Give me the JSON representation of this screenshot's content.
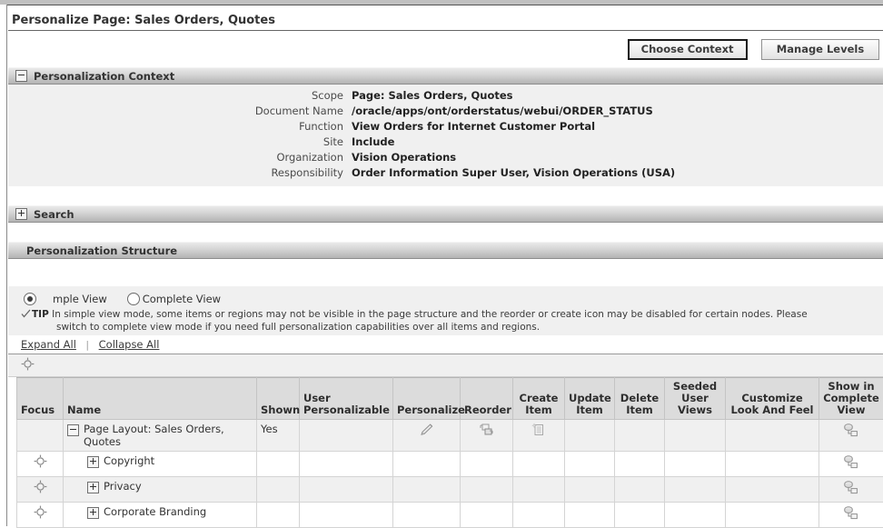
{
  "page": {
    "title": "Personalize Page: Sales Orders, Quotes"
  },
  "toolbar": {
    "choose_context_label": "Choose Context",
    "manage_levels_label": "Manage Levels"
  },
  "context_section": {
    "header": "Personalization Context",
    "toggle_icon": "minus-icon",
    "rows": [
      {
        "label": "Scope",
        "value": "Page: Sales Orders, Quotes"
      },
      {
        "label": "Document Name",
        "value": "/oracle/apps/ont/orderstatus/webui/ORDER_STATUS"
      },
      {
        "label": "Function",
        "value": "View Orders for Internet Customer Portal"
      },
      {
        "label": "Site",
        "value": "Include"
      },
      {
        "label": "Organization",
        "value": "Vision Operations"
      },
      {
        "label": "Responsibility",
        "value": "Order Information Super User, Vision Operations (USA)"
      }
    ]
  },
  "search_section": {
    "header": "Search",
    "toggle_icon": "plus-icon"
  },
  "structure_section": {
    "header": "Personalization Structure",
    "view_modes": [
      {
        "label": "mple View",
        "selected": true
      },
      {
        "label": "Complete View",
        "selected": false
      }
    ],
    "tip_label": "TIP",
    "tip_line1": "In simple view mode, some items or regions may not be visible in the page structure and the reorder or create icon may be disabled for certain nodes. Please",
    "tip_line2": "switch to complete view mode if you need full personalization capabilities over all items and regions.",
    "expand_all_label": "Expand All",
    "collapse_all_label": "Collapse All",
    "link_separator": "|"
  },
  "table": {
    "columns": [
      {
        "key": "focus",
        "label": "Focus",
        "align": "left"
      },
      {
        "key": "name",
        "label": "Name",
        "align": "left"
      },
      {
        "key": "shown",
        "label": "Shown",
        "align": "left"
      },
      {
        "key": "user_personalizable",
        "label": "User\nPersonalizable",
        "align": "left"
      },
      {
        "key": "personalize",
        "label": "Personalize",
        "align": "left"
      },
      {
        "key": "reorder",
        "label": "Reorder",
        "align": "left"
      },
      {
        "key": "create_item",
        "label": "Create\nItem",
        "align": "center"
      },
      {
        "key": "update_item",
        "label": "Update\nItem",
        "align": "center"
      },
      {
        "key": "delete_item",
        "label": "Delete\nItem",
        "align": "center"
      },
      {
        "key": "seeded_user_views",
        "label": "Seeded\nUser\nViews",
        "align": "center"
      },
      {
        "key": "customize_look_and_feel",
        "label": "Customize\nLook And Feel",
        "align": "center"
      },
      {
        "key": "show_in_complete_view",
        "label": "Show in\nComplete\nView",
        "align": "center"
      }
    ],
    "column_labels": {
      "focus": "Focus",
      "name": "Name",
      "shown": "Shown",
      "user_personalizable_l1": "User",
      "user_personalizable_l2": "Personalizable",
      "personalize": "Personalize",
      "reorder": "Reorder",
      "create_item_l1": "Create",
      "create_item_l2": "Item",
      "update_item_l1": "Update",
      "update_item_l2": "Item",
      "delete_item_l1": "Delete",
      "delete_item_l2": "Item",
      "seeded_l1": "Seeded",
      "seeded_l2": "User",
      "seeded_l3": "Views",
      "clf_l1": "Customize",
      "clf_l2": "Look And Feel",
      "sicv_l1": "Show in",
      "sicv_l2": "Complete",
      "sicv_l3": "View"
    },
    "rows": [
      {
        "focus_icon": "",
        "toggle_icon": "minus-icon",
        "name_line1": "Page Layout: Sales Orders,",
        "name_line2": "Quotes",
        "indent": 0,
        "shown": "Yes",
        "user_personalizable": "",
        "personalize_icon": "pencil-icon",
        "reorder_icon": "reorder-icon",
        "create_item_icon": "create-item-icon",
        "update_item_icon": "",
        "delete_item_icon": "",
        "seeded_user_views_icon": "",
        "customize_look_and_feel_icon": "",
        "show_in_complete_view_icon": "show-in-complete-view-icon",
        "stripe": "alt"
      },
      {
        "focus_icon": "focus-icon",
        "toggle_icon": "plus-icon",
        "name_line1": "Copyright",
        "name_line2": "",
        "indent": 1,
        "shown": "",
        "user_personalizable": "",
        "personalize_icon": "",
        "reorder_icon": "",
        "create_item_icon": "",
        "update_item_icon": "",
        "delete_item_icon": "",
        "seeded_user_views_icon": "",
        "customize_look_and_feel_icon": "",
        "show_in_complete_view_icon": "show-in-complete-view-icon",
        "stripe": "white"
      },
      {
        "focus_icon": "focus-icon",
        "toggle_icon": "plus-icon",
        "name_line1": "Privacy",
        "name_line2": "",
        "indent": 1,
        "shown": "",
        "user_personalizable": "",
        "personalize_icon": "",
        "reorder_icon": "",
        "create_item_icon": "",
        "update_item_icon": "",
        "delete_item_icon": "",
        "seeded_user_views_icon": "",
        "customize_look_and_feel_icon": "",
        "show_in_complete_view_icon": "show-in-complete-view-icon",
        "stripe": "alt"
      },
      {
        "focus_icon": "focus-icon",
        "toggle_icon": "plus-icon",
        "name_line1": "Corporate Branding",
        "name_line2": "",
        "indent": 1,
        "shown": "",
        "user_personalizable": "",
        "personalize_icon": "",
        "reorder_icon": "",
        "create_item_icon": "",
        "update_item_icon": "",
        "delete_item_icon": "",
        "seeded_user_views_icon": "",
        "customize_look_and_feel_icon": "",
        "show_in_complete_view_icon": "show-in-complete-view-icon",
        "stripe": "white"
      }
    ]
  },
  "colors": {
    "header_bar_top": "#e9e9e9",
    "header_bar_bottom": "#b3b3b3",
    "panel_bg": "#f0f0f0",
    "table_header_bg": "#dcdcdc",
    "text": "#333333",
    "link": "#3b3b3b"
  }
}
